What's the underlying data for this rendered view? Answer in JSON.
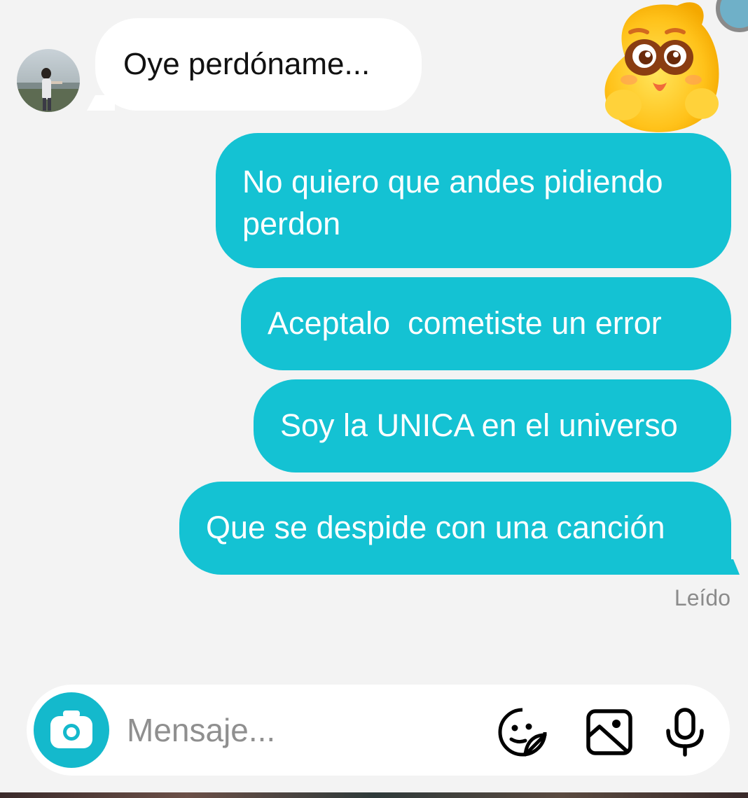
{
  "conversation": {
    "incoming": [
      {
        "text": "Oye perdóname..."
      }
    ],
    "outgoing": [
      {
        "text": "No quiero que andes pidiendo perdon"
      },
      {
        "text": "Aceptalo  cometiste un error"
      },
      {
        "text": "Soy la UNICA en el universo"
      },
      {
        "text": "Que se despide con una canción"
      }
    ],
    "read_status": "Leído"
  },
  "composer": {
    "placeholder": "Mensaje...",
    "icons": [
      "camera-icon",
      "sticker-icon",
      "gallery-icon",
      "microphone-icon"
    ]
  },
  "colors": {
    "outgoing_bubble": "#14c2d3",
    "incoming_bubble": "#ffffff",
    "background": "#f3f3f3",
    "camera_button": "#14b9cc"
  }
}
